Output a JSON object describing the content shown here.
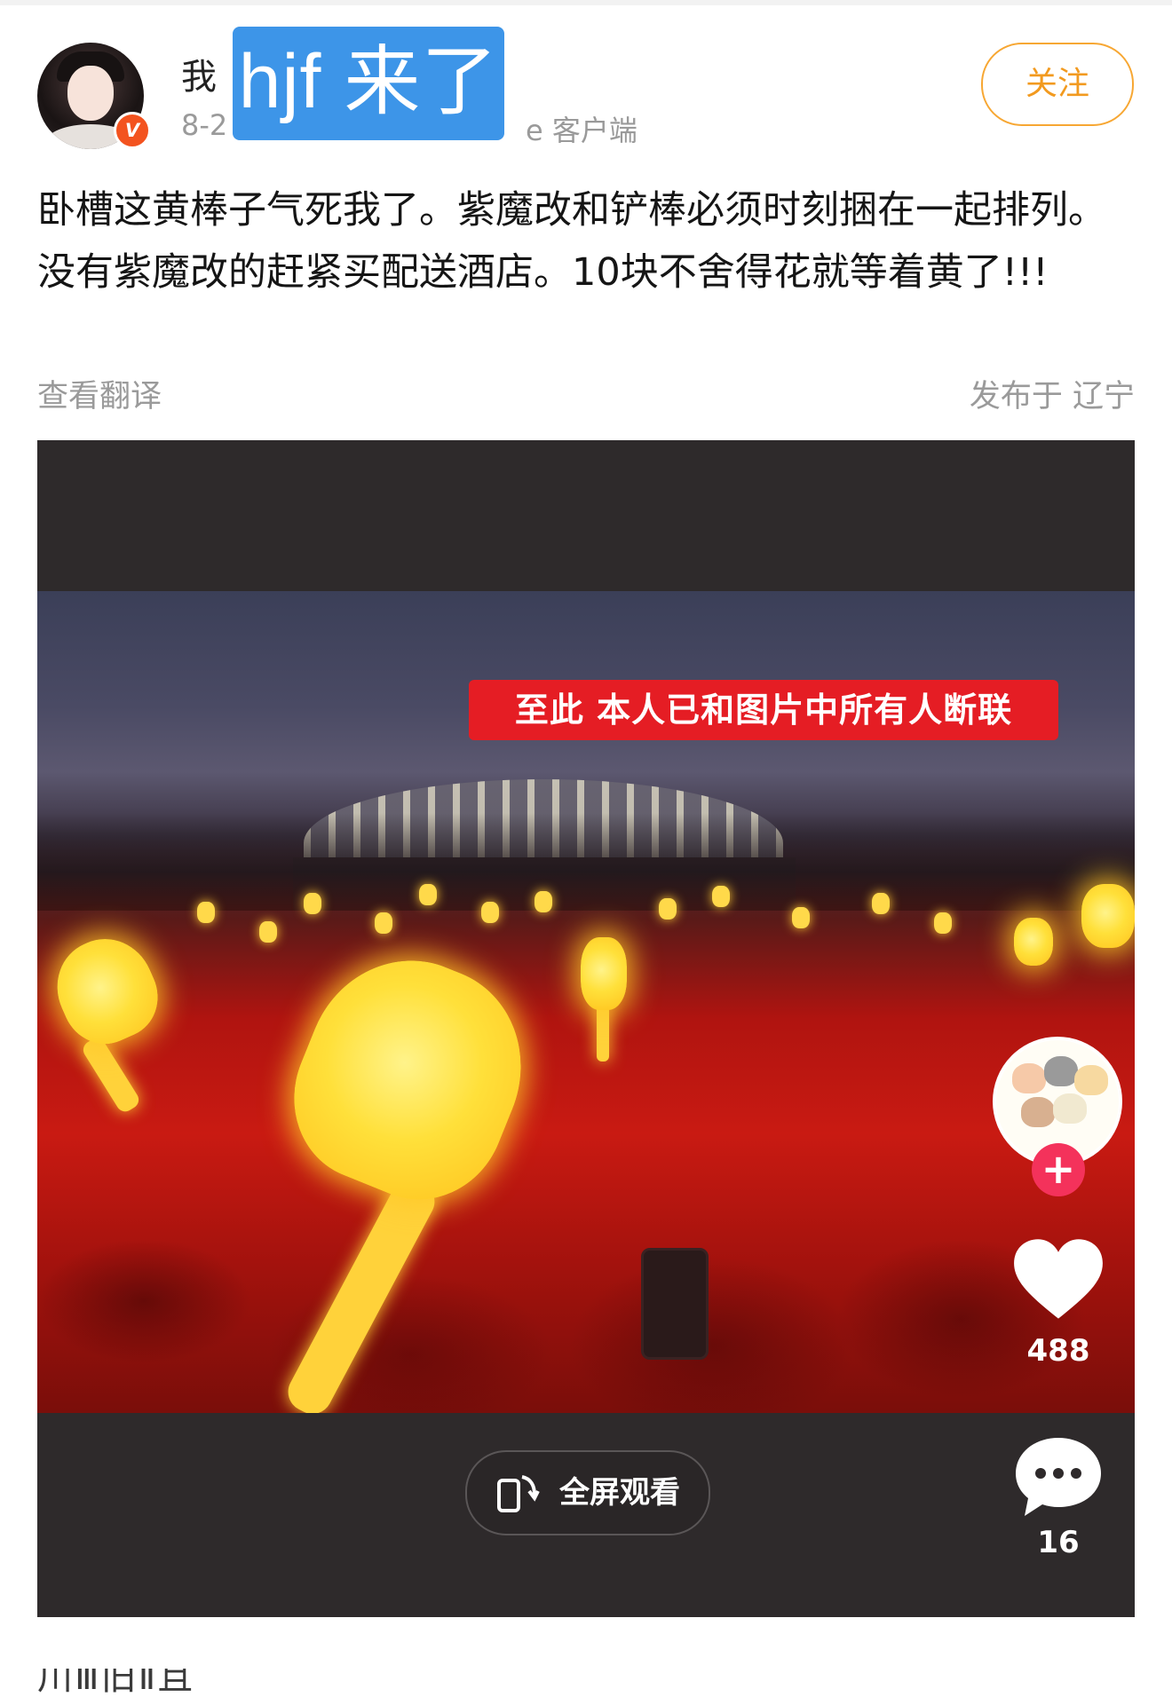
{
  "post": {
    "author_visible": "我",
    "time_visible": "8-2",
    "source_suffix": "e 客户端",
    "overlay_tag": "hjf 来了",
    "follow_label": "关注",
    "verified_badge": "V",
    "text": "卧槽这黄棒子气死我了。紫魔改和铲棒必须时刻捆在一起排列。没有紫魔改的赶紧买配送酒店。10块不舍得花就等着黄了!!!",
    "translate_label": "查看翻译",
    "location": "发布于 辽宁"
  },
  "video": {
    "caption": "至此 本人已和图片中所有人断联",
    "likes": "488",
    "comments": "16",
    "fullscreen_label": "全屏观看"
  },
  "footer": {
    "cut_text": "川Ⅲ旧Ⅱ且"
  },
  "colors": {
    "follow": "#f29a1f",
    "overlay_tag": "#3d95e8",
    "caption_bg": "#e51d24",
    "verified": "#f3531f",
    "plus": "#f4325b"
  }
}
